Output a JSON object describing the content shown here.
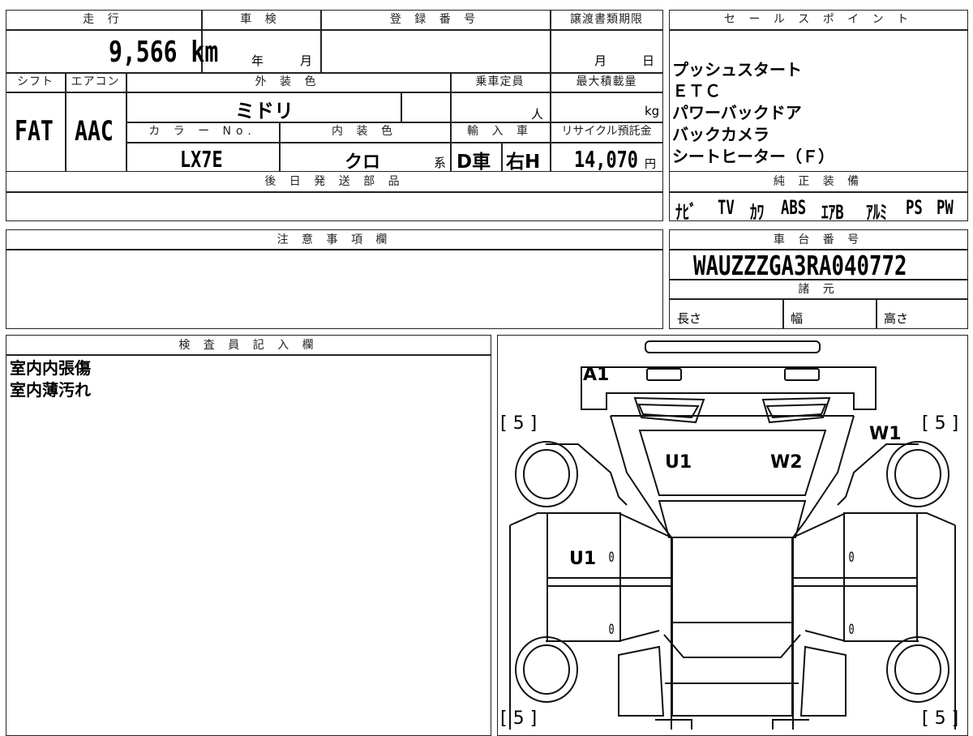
{
  "header_row": {
    "mileage_label": "走 行",
    "inspection_label": "車 検",
    "registration_label": "登 録 番 号",
    "transfer_deadline_label": "譲渡書類期限",
    "mileage_value": "9,566 km",
    "inspection_year_unit": "年",
    "inspection_month_unit": "月",
    "transfer_month_unit": "月",
    "transfer_day_unit": "日"
  },
  "spec_row": {
    "shift_label": "シフト",
    "aircon_label": "エアコン",
    "exterior_color_label": "外 装 色",
    "capacity_label": "乗車定員",
    "max_load_label": "最大積載量",
    "shift_value": "FAT",
    "aircon_value": "AAC",
    "exterior_color_value": "ミドリ",
    "capacity_unit": "人",
    "load_unit": "kg",
    "color_no_label": "カ ラ ー No.",
    "interior_color_label": "内 装 色",
    "import_label": "輸 入 車",
    "recycle_label": "リサイクル預託金",
    "color_no_value": "LX7E",
    "interior_color_value": "クロ",
    "interior_suffix": "系",
    "import_value": "D車",
    "handle_value": "右H",
    "recycle_value": "14,070",
    "recycle_unit": "円"
  },
  "later_parts_label": "後 日 発 送 部 品",
  "notes_label": "注 意 事 項 欄",
  "inspector_label": "検 査 員 記 入 欄",
  "inspector_notes": [
    "室内内張傷",
    "室内薄汚れ"
  ],
  "sales_points": {
    "label": "セ ー ル ス ポ イ ン ト",
    "items": [
      "プッシュスタート",
      "ＥＴＣ",
      "パワーバックドア",
      "バックカメラ",
      "シートヒーター（Ｆ）"
    ]
  },
  "standard_equipment": {
    "label": "純 正 装 備",
    "items": [
      "ﾅﾋﾞ",
      "TV",
      "ｶﾜ",
      "ABS",
      "ｴｱB",
      "ｱﾙﾐ",
      "PS",
      "PW"
    ]
  },
  "chassis": {
    "label": "車 台 番 号",
    "number": "WAUZZZGA3RA040772"
  },
  "dimensions": {
    "label": "諸 元",
    "length_label": "長さ",
    "width_label": "幅",
    "height_label": "高さ"
  },
  "diagram": {
    "marks": [
      "A1",
      "U1",
      "W2",
      "W1",
      "U1"
    ],
    "tire_scores": [
      "[ 5 ]",
      "[ 5 ]",
      "[ 5 ]",
      "[ 5 ]"
    ],
    "door_scores": [
      "0",
      "0",
      "0",
      "0"
    ]
  }
}
